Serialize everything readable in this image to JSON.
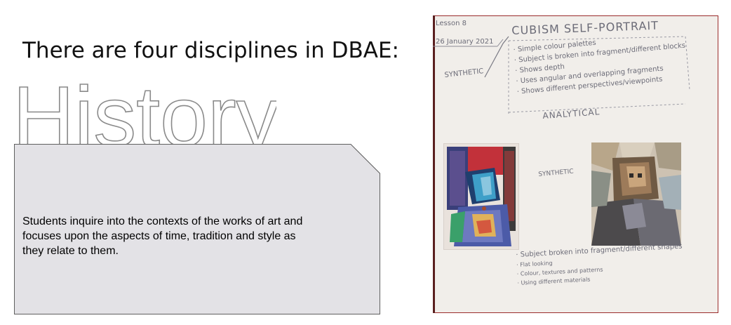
{
  "slide": {
    "heading": "There are four disciplines in DBAE:",
    "discipline": "History",
    "description_lines": [
      "Students inquire into the contexts of  the works of art and",
      "focuses upon the aspects of time, tradition and style as",
      "they relate to them."
    ]
  },
  "notebook": {
    "lesson": "Lesson 8",
    "date": "26 January 2021",
    "title": "CUBISM SELF-PORTRAIT",
    "label_synthetic": "SYNTHETIC",
    "label_analytical": "ANALYTICAL",
    "label_synthetic_mid": "SYNTHETIC",
    "top_notes": [
      "· Simple colour palettes",
      "· Subject is broken into fragment/different blocks",
      "· Shows depth",
      "· Uses angular and overlapping fragments",
      "· Shows different perspectives/viewpoints"
    ],
    "bottom_notes": [
      "· Subject broken into fragment/different shapes",
      "· Flat looking",
      "· Colour, textures and patterns",
      "· Using different materials"
    ]
  },
  "colors": {
    "callout_fill": "#e3e2e6",
    "callout_stroke": "#5f5f5f",
    "outline_text_stroke": "#8a8a8a",
    "paper": "#f1eeea",
    "ink": "#6c6c78"
  }
}
